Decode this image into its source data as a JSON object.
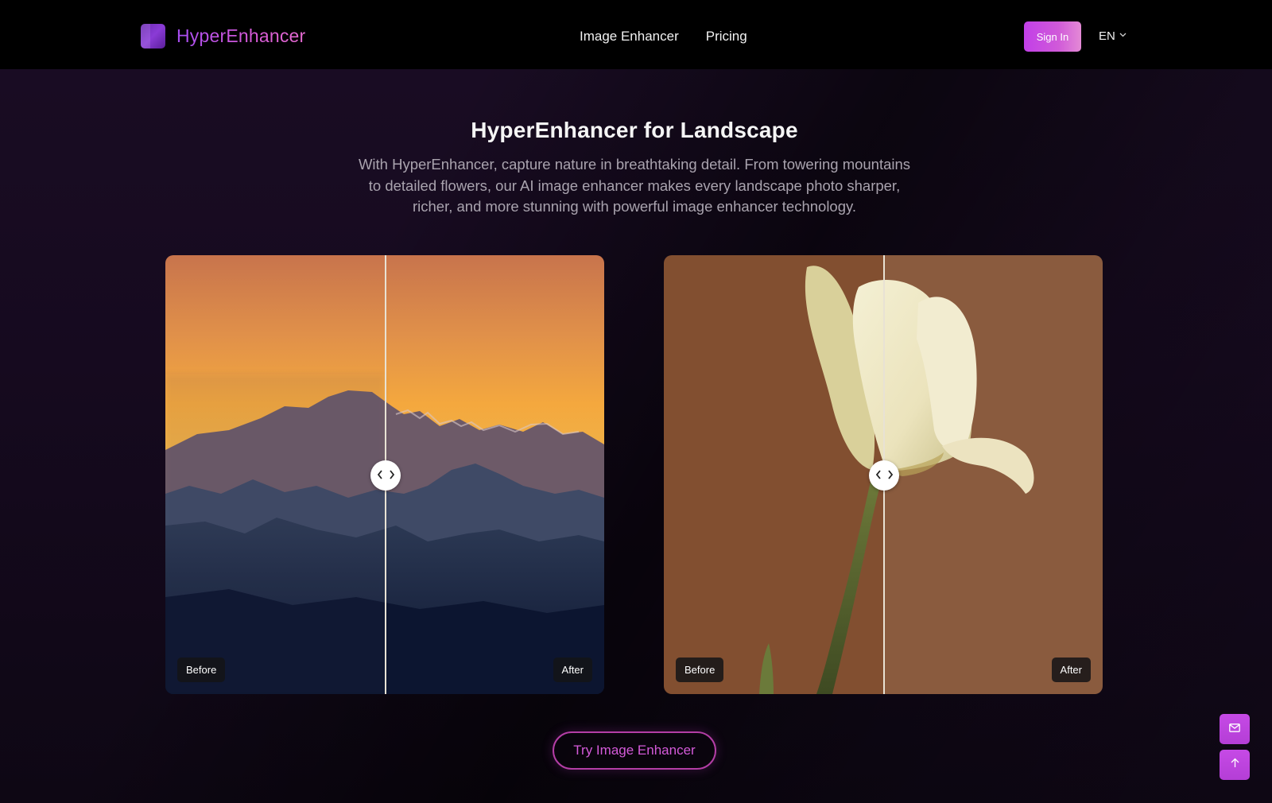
{
  "header": {
    "brand": "HyperEnhancer",
    "nav": [
      "Image Enhancer",
      "Pricing"
    ],
    "sign_in": "Sign In",
    "language": "EN"
  },
  "hero": {
    "title": "HyperEnhancer for Landscape",
    "description": "With HyperEnhancer, capture nature in breathtaking detail. From towering mountains to detailed flowers, our AI image enhancer makes every landscape photo sharper, richer, and more stunning with powerful image enhancer technology."
  },
  "comparisons": [
    {
      "subject": "mountains at sunset",
      "before_label": "Before",
      "after_label": "After"
    },
    {
      "subject": "white tulip",
      "before_label": "Before",
      "after_label": "After"
    }
  ],
  "cta": {
    "label": "Try Image Enhancer"
  },
  "floating": {
    "contact_icon": "mail-icon",
    "top_icon": "arrow-up-icon"
  },
  "colors": {
    "accent": "#c23fe8",
    "accent_pink": "#d45ad9",
    "background": "#140a1c"
  }
}
